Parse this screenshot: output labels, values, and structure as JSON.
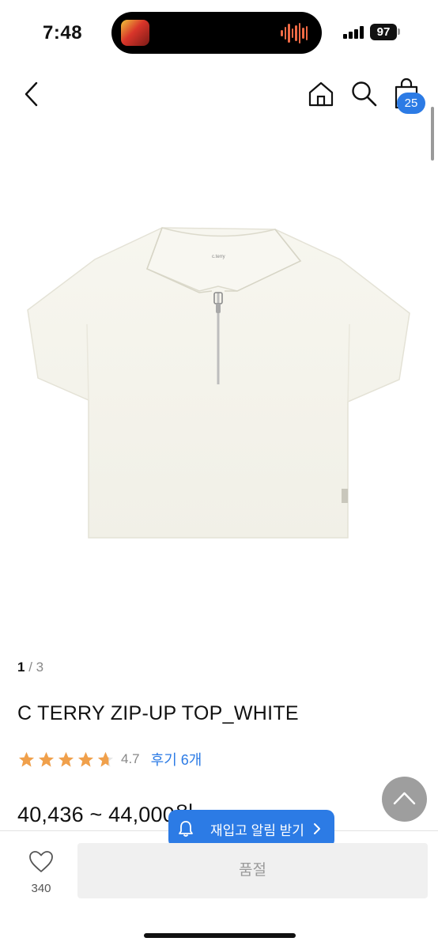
{
  "status_bar": {
    "time": "7:48",
    "battery": "97"
  },
  "header": {
    "cart_count": "25"
  },
  "gallery": {
    "current": "1",
    "separator": "/",
    "total": "3",
    "label_text": "c.terry"
  },
  "product": {
    "title": "C TERRY ZIP-UP TOP_WHITE",
    "rating": "4.7",
    "rating_value": 4.7,
    "reviews_label": "후기 6개",
    "price": "40,436 ~ 44,000원"
  },
  "restock_toast": {
    "label": "재입고 알림 받기"
  },
  "bottom_bar": {
    "like_count": "340",
    "soldout_label": "품절"
  },
  "colors": {
    "accent": "#2c7be5",
    "star": "#f0a04b",
    "soldout_bg": "#f0f0f0",
    "scroll_top_bg": "#9e9e9e"
  },
  "icons": [
    "back-icon",
    "home-icon",
    "search-icon",
    "shopping-bag-icon",
    "star-icon",
    "bell-icon",
    "chevron-right-icon",
    "chevron-up-icon",
    "heart-icon"
  ]
}
